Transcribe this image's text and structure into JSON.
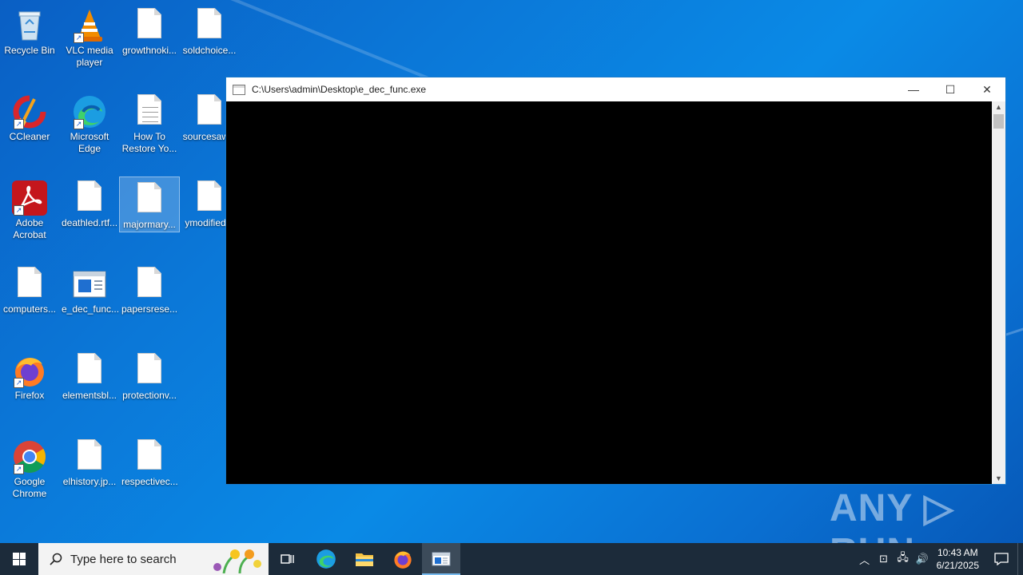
{
  "desktop": {
    "icons": [
      {
        "label": "Recycle Bin"
      },
      {
        "label": "VLC media player"
      },
      {
        "label": "growthnoki..."
      },
      {
        "label": "soldchoice..."
      },
      {
        "label": "CCleaner"
      },
      {
        "label": "Microsoft Edge"
      },
      {
        "label": "How To Restore Yo..."
      },
      {
        "label": "sourcesaw..."
      },
      {
        "label": "Adobe Acrobat"
      },
      {
        "label": "deathled.rtf..."
      },
      {
        "label": "majormary..."
      },
      {
        "label": "ymodified..."
      },
      {
        "label": "computers..."
      },
      {
        "label": "e_dec_func..."
      },
      {
        "label": "papersrese..."
      },
      {
        "label": "Firefox"
      },
      {
        "label": "elementsbl..."
      },
      {
        "label": "protectionv..."
      },
      {
        "label": "Google Chrome"
      },
      {
        "label": "elhistory.jp..."
      },
      {
        "label": "respectivec..."
      }
    ]
  },
  "window": {
    "title": "C:\\Users\\admin\\Desktop\\e_dec_func.exe",
    "minimize": "—",
    "maximize": "☐",
    "close": "✕"
  },
  "watermark": "ANY ▷ RUN",
  "taskbar": {
    "search_placeholder": "Type here to search",
    "time": "10:43 AM",
    "date": "6/21/2025",
    "accent": "#76b9ed"
  }
}
